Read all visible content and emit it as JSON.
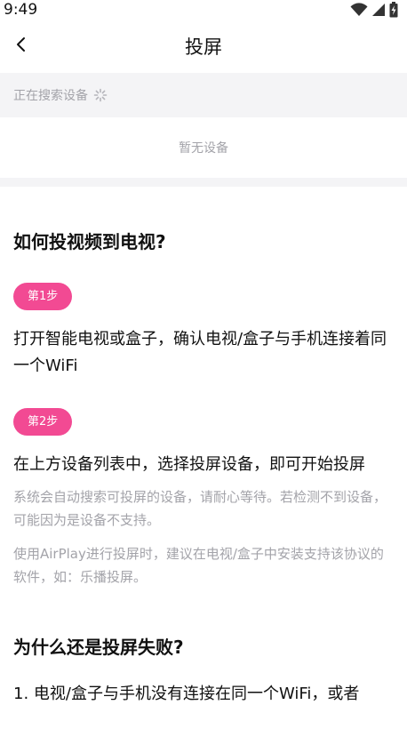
{
  "status_bar": {
    "time": "9:49",
    "icons": [
      "wifi-icon",
      "signal-icon",
      "battery-charging-icon"
    ]
  },
  "nav": {
    "back_icon": "chevron-left-icon",
    "title": "投屏"
  },
  "search": {
    "label": "正在搜索设备",
    "spinner_icon": "loading-spinner-icon"
  },
  "devices": {
    "empty_text": "暂无设备"
  },
  "help": {
    "title": "如何投视频到电视?",
    "steps": [
      {
        "badge": "第1步",
        "text": "打开智能电视或盒子，确认电视/盒子与手机连接着同一个WiFi"
      },
      {
        "badge": "第2步",
        "text": "在上方设备列表中，选择投屏设备，即可开始投屏"
      }
    ],
    "notes": [
      "系统会自动搜索可投屏的设备，请耐心等待。若检测不到设备，可能因为是设备不支持。",
      "使用AirPlay进行投屏时，建议在电视/盒子中安装支持该协议的软件，如：乐播投屏。"
    ],
    "fail_title": "为什么还是投屏失败?",
    "fail_items": [
      "1. 电视/盒子与手机没有连接在同一个WiFi，或者"
    ]
  },
  "colors": {
    "accent": "#f24a93",
    "muted_text": "#a3a3a9",
    "section_bg": "#f4f4f6"
  }
}
